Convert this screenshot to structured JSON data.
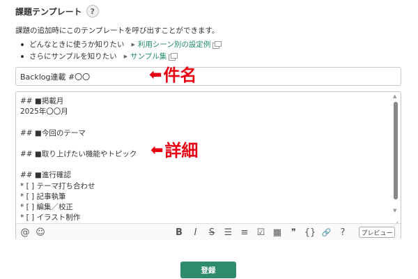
{
  "header": {
    "title": "課題テンプレート",
    "help_icon": "question-circle-icon"
  },
  "description": "課題の追加時にこのテンプレートを呼び出すことができます。",
  "bullets": [
    {
      "text": "どんなときに使うか知りたい",
      "link": "利用シーン別の設定例"
    },
    {
      "text": "さらにサンプルを知りたい",
      "link": "サンプル集"
    }
  ],
  "subject": {
    "value": "Backlog連載 #〇〇"
  },
  "annotations": {
    "subject_label": "件名",
    "detail_label": "詳細",
    "arrow": "⬅",
    "color": "#e60012"
  },
  "detail": {
    "lines": [
      "## ■掲載月",
      "2025年〇〇月",
      "",
      "## ■今回のテーマ",
      "",
      "## ■取り上げたい機能やトピック",
      "",
      "## ■進行確認",
      "* [ ] テーマ打ち合わせ",
      "* [ ] 記事執筆",
      "* [ ] 編集／校正",
      "* [ ] イラスト制作"
    ]
  },
  "toolbar": {
    "left_icons": [
      {
        "name": "mention-icon",
        "glyph": "@"
      },
      {
        "name": "emoji-icon",
        "glyph": "☺"
      }
    ],
    "right_icons": [
      {
        "name": "bold-icon",
        "glyph": "B"
      },
      {
        "name": "italic-icon",
        "glyph": "I"
      },
      {
        "name": "strikethrough-icon",
        "glyph": "S"
      },
      {
        "name": "bullet-list-icon",
        "glyph": "☰"
      },
      {
        "name": "numbered-list-icon",
        "glyph": "≡"
      },
      {
        "name": "checklist-icon",
        "glyph": "☑"
      },
      {
        "name": "table-icon",
        "glyph": "▦"
      },
      {
        "name": "quote-icon",
        "glyph": "❞"
      },
      {
        "name": "code-icon",
        "glyph": "{}"
      },
      {
        "name": "link-icon",
        "glyph": "🔗"
      },
      {
        "name": "help-icon",
        "glyph": "?"
      }
    ],
    "preview_label": "プレビュー"
  },
  "submit": {
    "label": "登録",
    "color": "#2e8b6b"
  },
  "colors": {
    "link": "#1f8a6d",
    "border": "#c8c8c8"
  }
}
